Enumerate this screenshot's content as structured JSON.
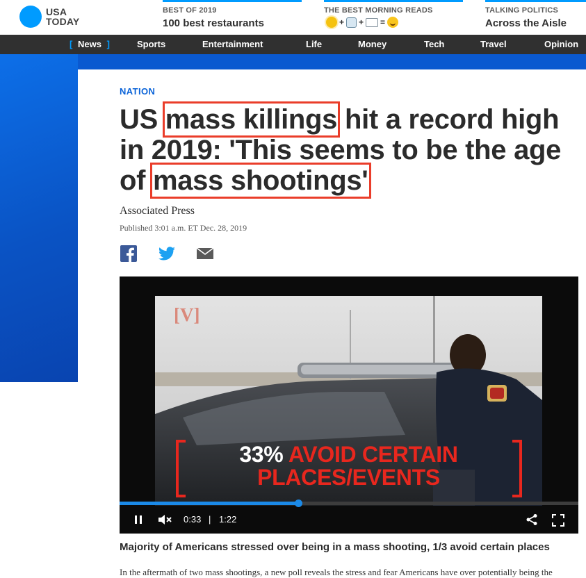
{
  "logo": {
    "line1": "USA",
    "line2": "TODAY"
  },
  "promos": [
    {
      "kicker": "BEST OF 2019",
      "headline": "100 best restaurants"
    },
    {
      "kicker": "THE BEST MORNING READS",
      "emoji_sequence": [
        "sun-icon",
        "+",
        "coffee-cup-icon",
        "+",
        "newspaper-icon",
        "=",
        "smiley-icon"
      ]
    },
    {
      "kicker": "TALKING POLITICS",
      "headline": "Across the Aisle"
    }
  ],
  "nav": {
    "items": [
      "News",
      "Sports",
      "Entertainment",
      "Life",
      "Money",
      "Tech",
      "Travel",
      "Opinion"
    ],
    "active": "News",
    "bracket_left": "[",
    "bracket_right": "]"
  },
  "article": {
    "section": "NATION",
    "title_parts": [
      "US ",
      "mass killings",
      " hit a record high in 2019: 'This seems to be the age of ",
      "mass shootings'"
    ],
    "byline": "Associated Press",
    "published": "Published 3:01 a.m. ET Dec. 28, 2019"
  },
  "share": {
    "icons": [
      "facebook-icon",
      "twitter-icon",
      "email-icon"
    ]
  },
  "video": {
    "watermark": "[V]",
    "overlay_number": "33%",
    "overlay_line1": "AVOID CERTAIN",
    "overlay_line2": "PLACES/EVENTS",
    "current_time": "0:33",
    "separator": "|",
    "duration": "1:22",
    "progress": 0.39,
    "caption": "Majority of Americans stressed over being in a mass shooting, 1/3 avoid certain places",
    "body_preview": "In the aftermath of two mass shootings, a new poll reveals the stress and fear Americans have over potentially being the"
  },
  "colors": {
    "brand_blue": "#009bff",
    "highlight_red": "#ea3d2a",
    "overlay_red": "#e8271e",
    "nav_bg": "#303030"
  }
}
